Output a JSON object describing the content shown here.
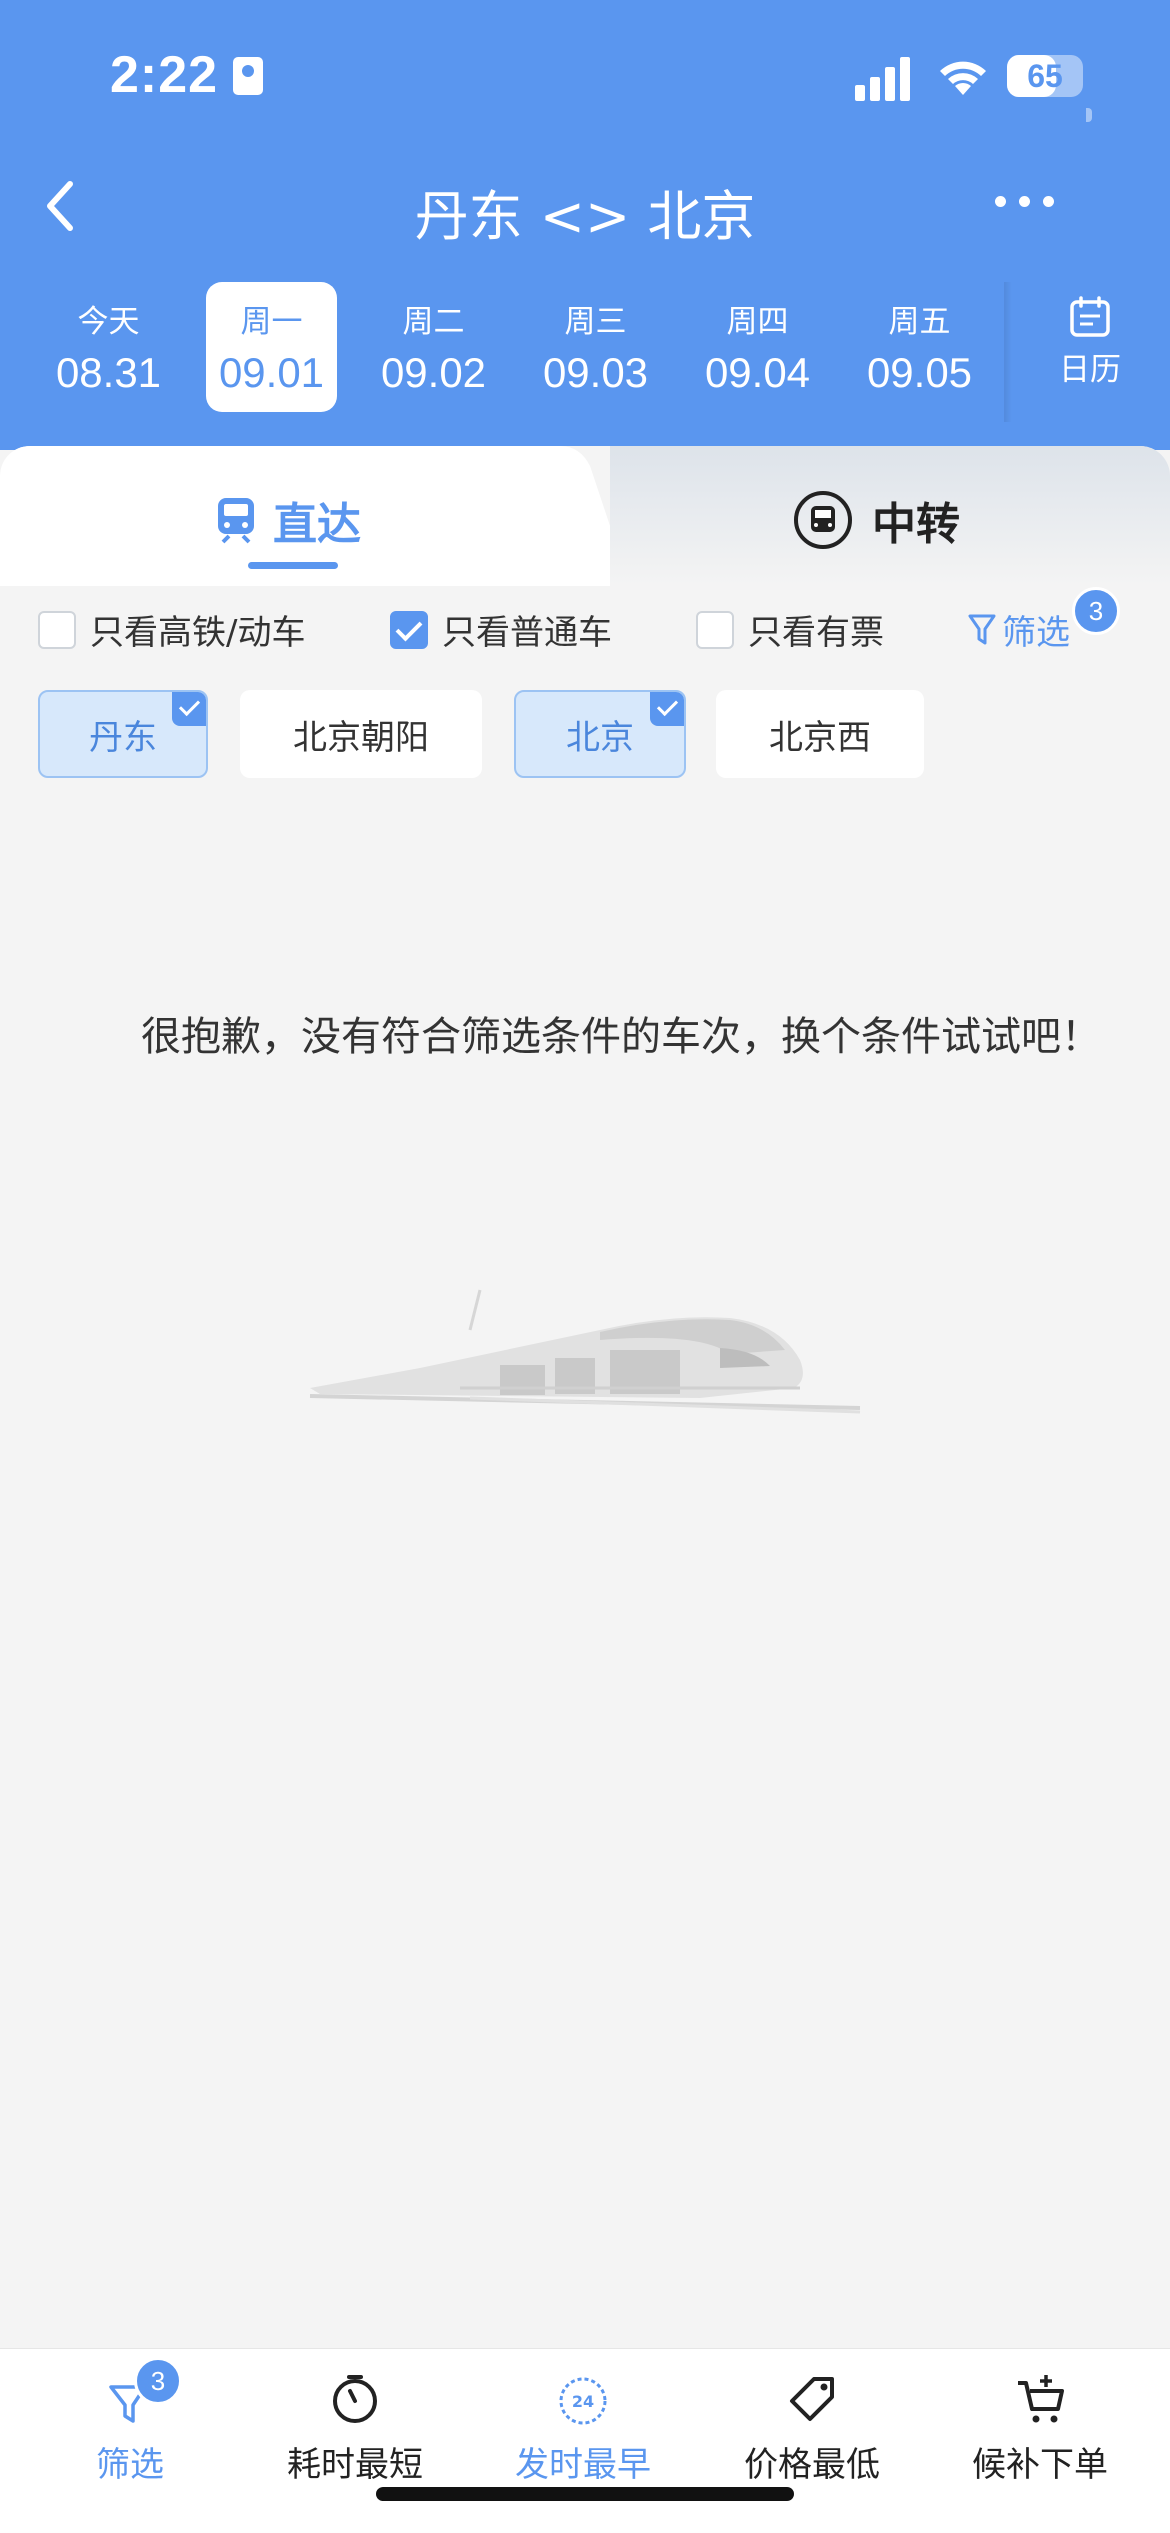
{
  "status_bar": {
    "time": "2:22",
    "battery": "65",
    "battery_level": 0.65
  },
  "header": {
    "title": "丹东 <> 北京",
    "back_icon": "chevron-left-icon",
    "more_icon": "more-dots-icon"
  },
  "dates": [
    {
      "weekday": "今天",
      "date": "08.31",
      "active": false
    },
    {
      "weekday": "周一",
      "date": "09.01",
      "active": true
    },
    {
      "weekday": "周二",
      "date": "09.02",
      "active": false
    },
    {
      "weekday": "周三",
      "date": "09.03",
      "active": false
    },
    {
      "weekday": "周四",
      "date": "09.04",
      "active": false
    },
    {
      "weekday": "周五",
      "date": "09.05",
      "active": false
    }
  ],
  "calendar": {
    "label": "日历",
    "icon": "calendar-icon"
  },
  "tabs": {
    "direct": "直达",
    "transfer": "中转",
    "active": "direct"
  },
  "filters": {
    "high_speed": {
      "label": "只看高铁/动车",
      "checked": false
    },
    "normal": {
      "label": "只看普通车",
      "checked": true
    },
    "available": {
      "label": "只看有票",
      "checked": false
    },
    "filter_link": "筛选",
    "filter_count": "3"
  },
  "stations": [
    {
      "name": "丹东",
      "selected": true
    },
    {
      "name": "北京朝阳",
      "selected": false
    },
    {
      "name": "北京",
      "selected": true
    },
    {
      "name": "北京西",
      "selected": false
    }
  ],
  "empty_message": "很抱歉，没有符合筛选条件的车次，换个条件试试吧！",
  "bottom_bar": [
    {
      "label": "筛选",
      "icon": "filter-icon",
      "badge": "3",
      "active": true
    },
    {
      "label": "耗时最短",
      "icon": "timer-icon",
      "active": false
    },
    {
      "label": "发时最早",
      "icon": "clock-24-icon",
      "active": true
    },
    {
      "label": "价格最低",
      "icon": "price-tag-icon",
      "active": false
    },
    {
      "label": "候补下单",
      "icon": "cart-add-icon",
      "active": false
    }
  ],
  "colors": {
    "primary": "#5a96ef",
    "background": "#f4f4f4"
  }
}
